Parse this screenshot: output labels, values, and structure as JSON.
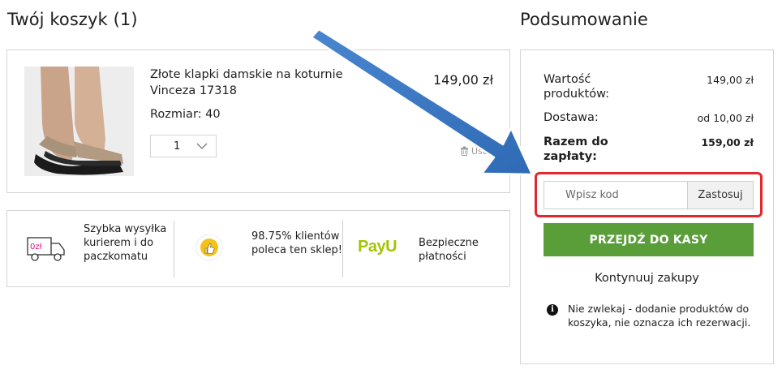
{
  "cart": {
    "title": "Twój koszyk (1)"
  },
  "product": {
    "name": "Złote klapki damskie na koturnie Vinceza 17318",
    "size_label": "Rozmiar: 40",
    "quantity": "1",
    "price": "149,00 zł",
    "remove_label": "Usuń"
  },
  "benefits": [
    {
      "icon": "delivery-truck-icon",
      "badge": "0zł",
      "text": "Szybka wysyłka kurierem i do paczkomatu"
    },
    {
      "icon": "thumbs-up-badge-icon",
      "text": "98.75% klientów poleca ten sklep!"
    },
    {
      "icon": "payu-logo",
      "logo_text": "PayU",
      "text": "Bezpieczne płatności"
    }
  ],
  "summary": {
    "title": "Podsumowanie",
    "products_label": "Wartość produktów:",
    "products_value": "149,00 zł",
    "shipping_label": "Dostawa:",
    "shipping_value": "od 10,00 zł",
    "total_label": "Razem do zapłaty:",
    "total_value": "159,00 zł",
    "coupon_placeholder": "Wpisz kod",
    "coupon_button": "Zastosuj",
    "checkout_button": "PRZEJDŹ DO KASY",
    "continue_link": "Kontynuuj zakupy",
    "info_note": "Nie zwlekaj - dodanie produktów do koszyka, nie oznacza ich rezerwacji."
  },
  "colors": {
    "checkout_green": "#5a9e3a",
    "highlight_red": "#e0282e",
    "arrow_blue": "#3a78c2",
    "payu_green": "#a6c307",
    "badge_magenta": "#e0107a"
  }
}
